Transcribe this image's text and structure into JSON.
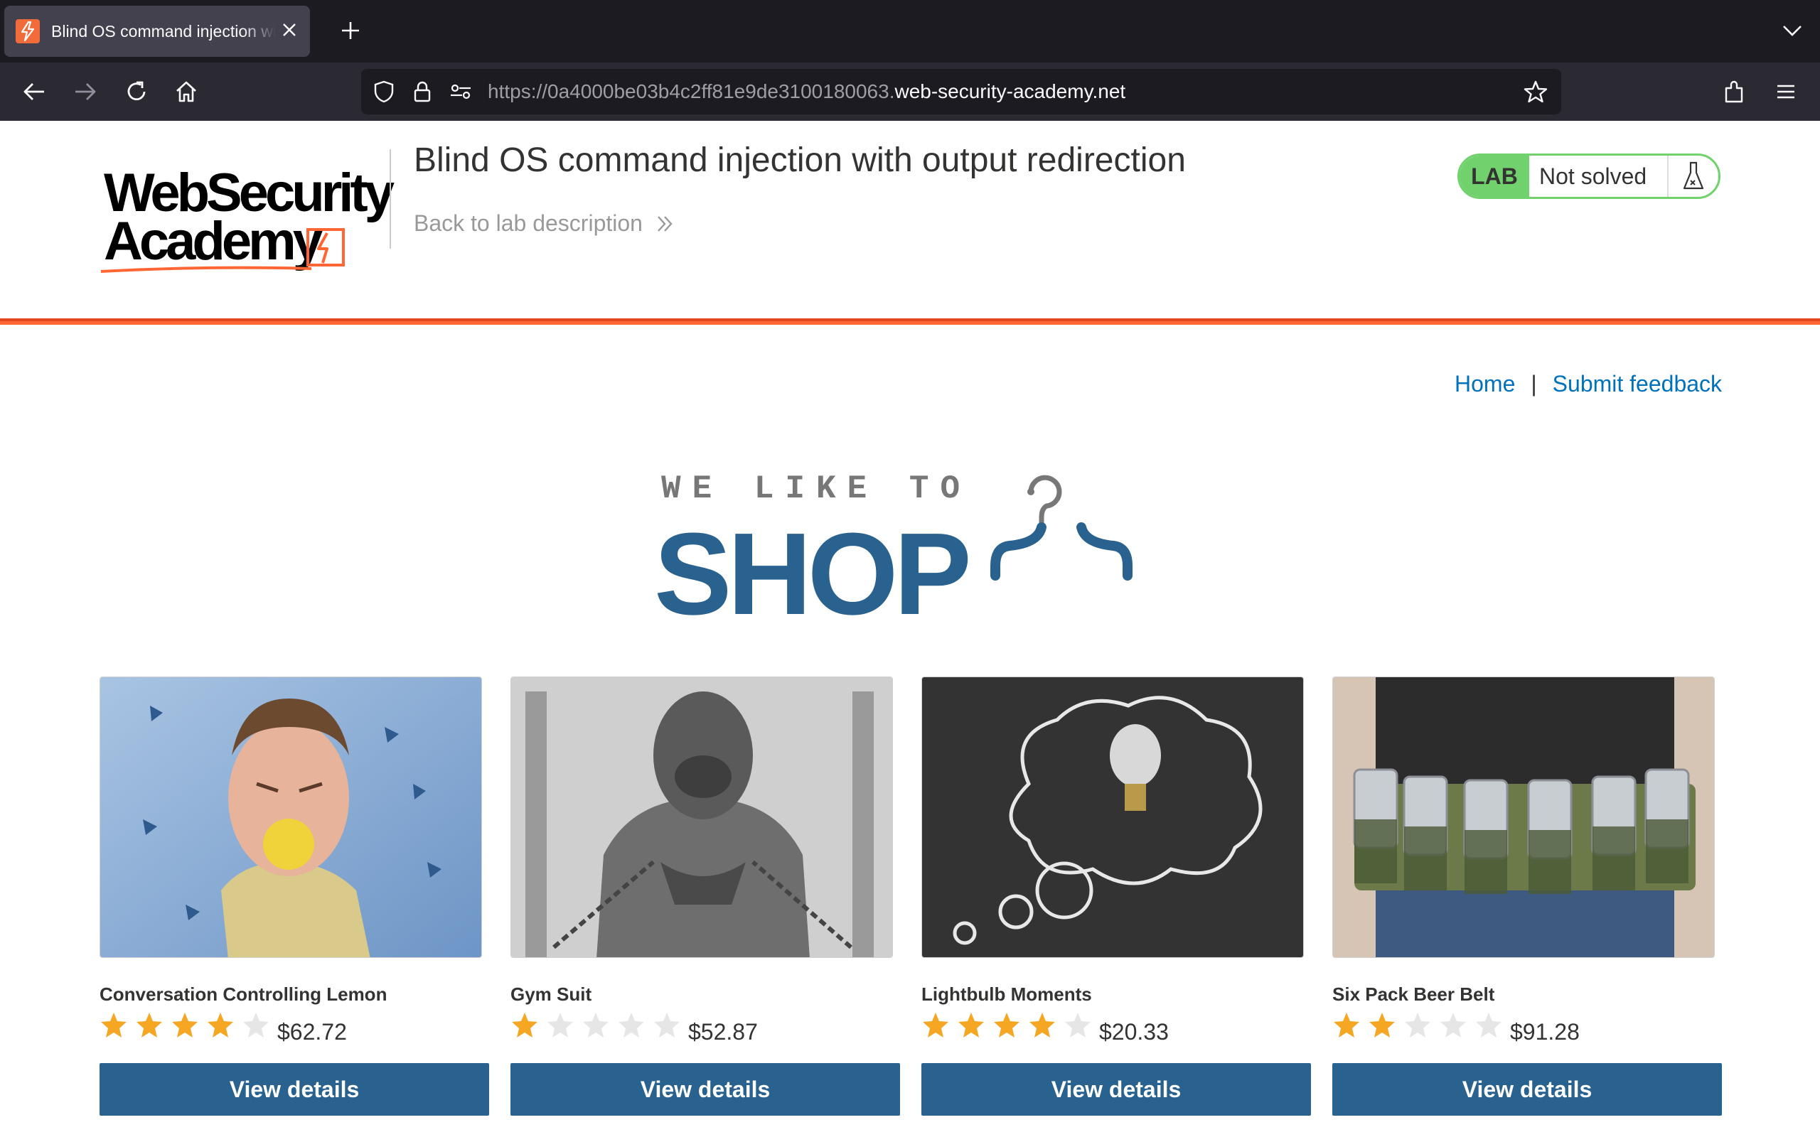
{
  "browser": {
    "tab_title": "Blind OS command injection with output redirection",
    "url_prefix": "https://0a4000be03b4c2ff81e9de3100180063.",
    "url_domain": "web-security-academy.net"
  },
  "header": {
    "logo_line1": "WebSecurity",
    "logo_line2": "Academy",
    "lab_title": "Blind OS command injection with output redirection",
    "back_link": "Back to lab description",
    "lab_badge": "LAB",
    "lab_status": "Not solved"
  },
  "nav": {
    "home": "Home",
    "separator": "|",
    "feedback": "Submit feedback"
  },
  "banner": {
    "small": "WE LIKE TO",
    "big": "SHOP"
  },
  "colors": {
    "accent_orange": "#ff6633",
    "shop_blue": "#29628f",
    "link_blue": "#0071bc",
    "lab_green": "#70d16d",
    "star_filled": "#f5a623",
    "star_empty": "#e6e6e6"
  },
  "products": [
    {
      "name": "Conversation Controlling Lemon",
      "rating": 4,
      "price": "$62.72",
      "button": "View details"
    },
    {
      "name": "Gym Suit",
      "rating": 1,
      "price": "$52.87",
      "button": "View details"
    },
    {
      "name": "Lightbulb Moments",
      "rating": 4,
      "price": "$20.33",
      "button": "View details"
    },
    {
      "name": "Six Pack Beer Belt",
      "rating": 2,
      "price": "$91.28",
      "button": "View details"
    }
  ]
}
